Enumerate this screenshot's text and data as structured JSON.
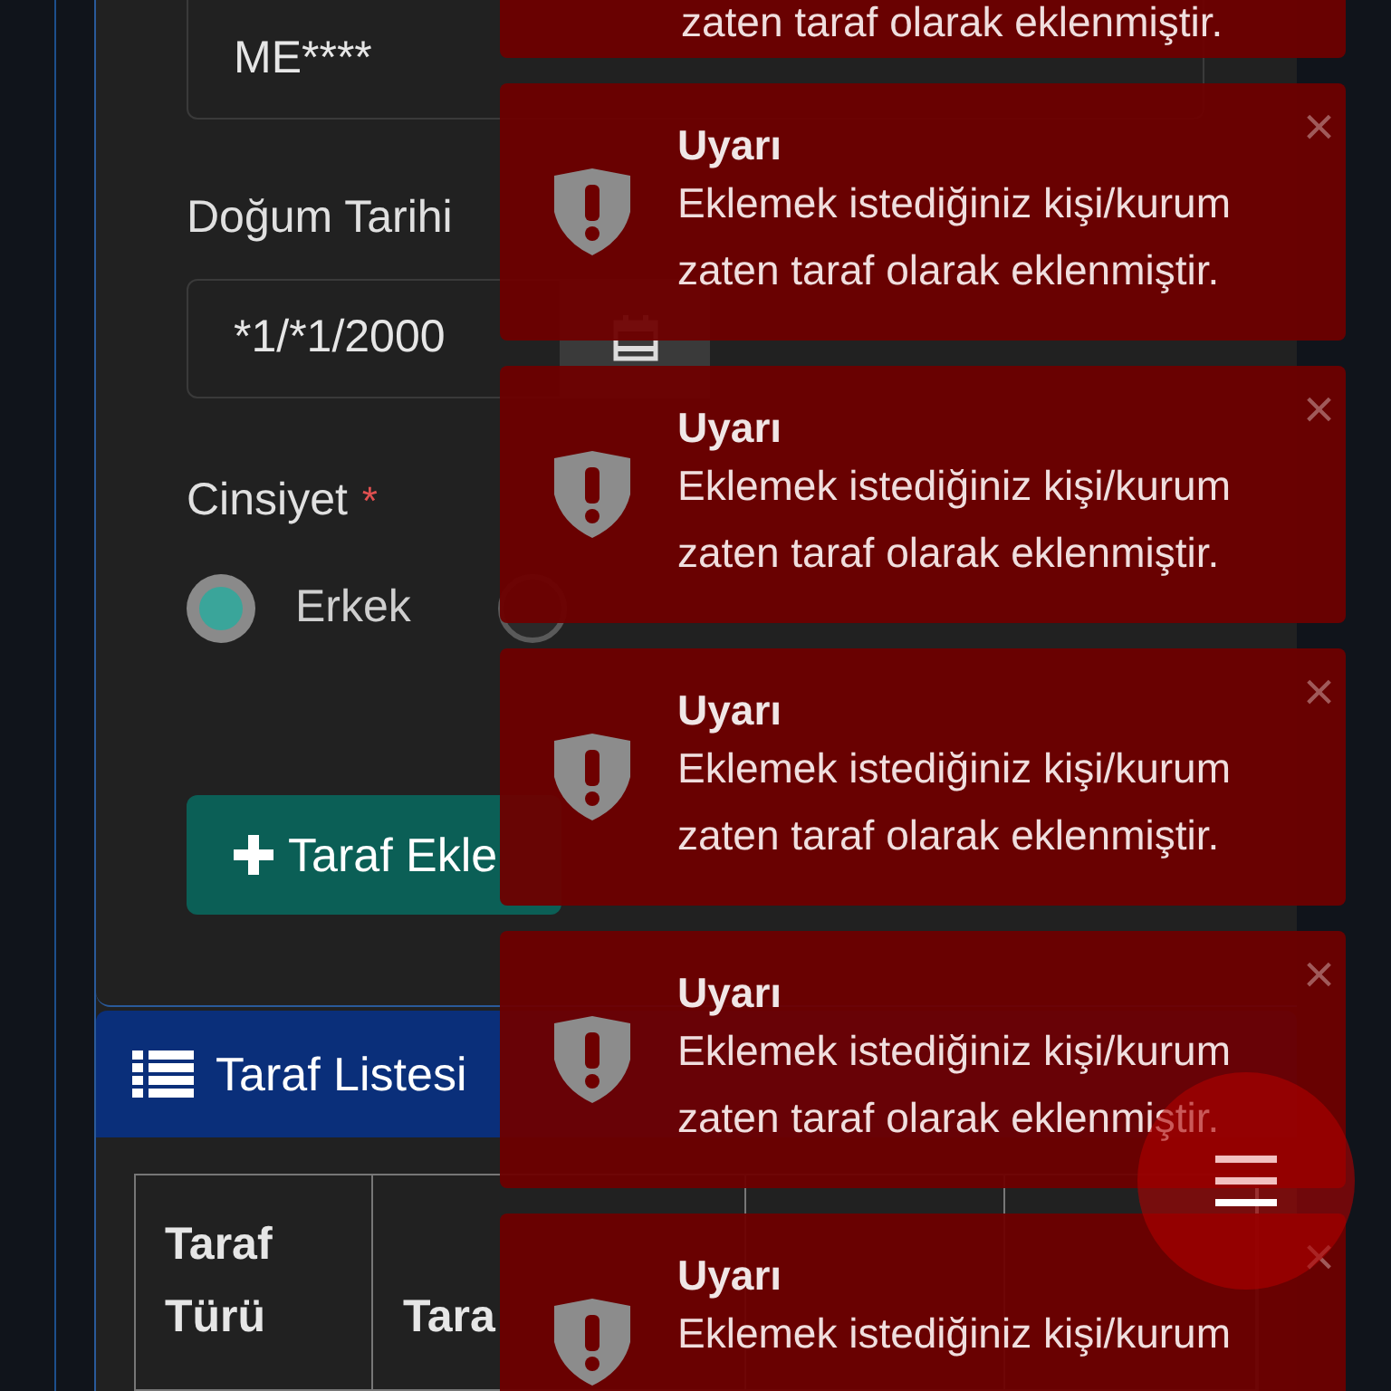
{
  "form": {
    "id_value": "ME****",
    "birth_label": "Doğum Tarihi",
    "birth_value": "*1/*1/2000",
    "gender_label": "Cinsiyet",
    "required_mark": "*",
    "gender_options": [
      {
        "label": "Erkek",
        "selected": true
      },
      {
        "selected": false
      }
    ],
    "add_button": "Taraf Ekle"
  },
  "list_panel": {
    "title": "Taraf Listesi",
    "columns": [
      "Taraf Türü",
      "Tara"
    ]
  },
  "toasts": [
    {
      "kind": "partial",
      "message": "zaten taraf olarak eklenmiştir."
    },
    {
      "kind": "full",
      "title": "Uyarı",
      "message": "Eklemek istediğiniz kişi/kurum zaten taraf olarak eklenmiştir.",
      "close": "×"
    },
    {
      "kind": "full",
      "title": "Uyarı",
      "message": "Eklemek istediğiniz kişi/kurum zaten taraf olarak eklenmiştir.",
      "close": "×"
    },
    {
      "kind": "full",
      "title": "Uyarı",
      "message": "Eklemek istediğiniz kişi/kurum zaten taraf olarak eklenmiştir.",
      "close": "×"
    },
    {
      "kind": "full",
      "title": "Uyarı",
      "message": "Eklemek istediğiniz kişi/kurum zaten taraf olarak eklenmiştir.",
      "close": "×"
    },
    {
      "kind": "full",
      "title": "Uyarı",
      "message": "Eklemek istediğiniz kişi/kurum",
      "close": "×"
    }
  ]
}
